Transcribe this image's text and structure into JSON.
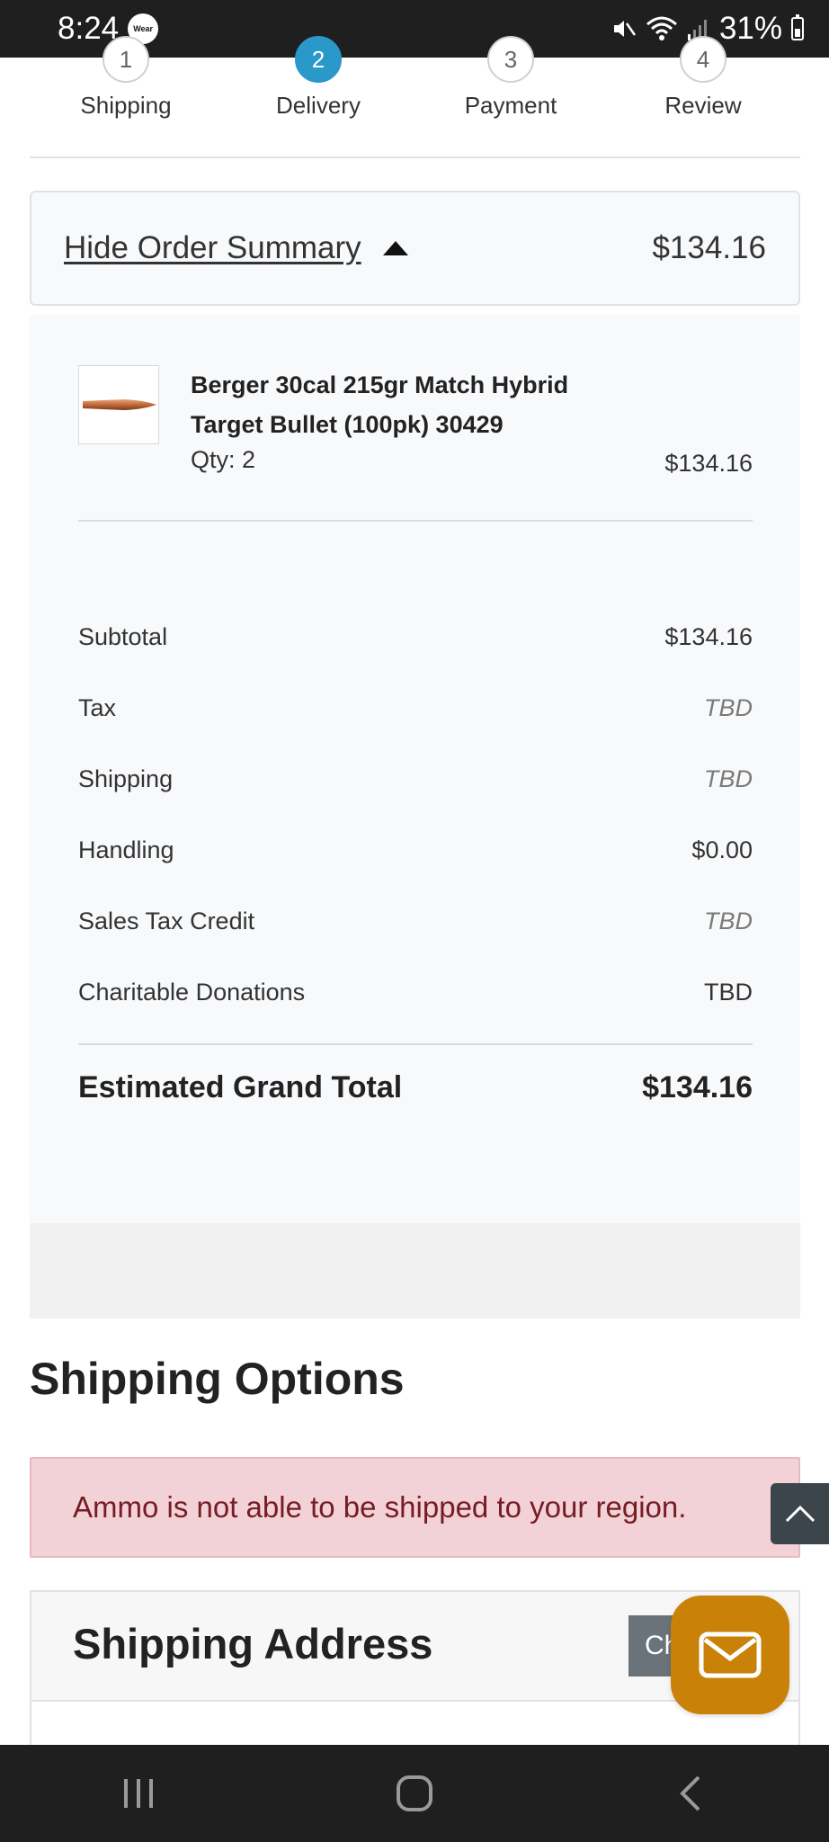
{
  "status_bar": {
    "time": "8:24",
    "wear_label": "Wear",
    "battery": "31%"
  },
  "stepper": [
    {
      "number": "1",
      "label": "Shipping",
      "active": false
    },
    {
      "number": "2",
      "label": "Delivery",
      "active": true
    },
    {
      "number": "3",
      "label": "Payment",
      "active": false
    },
    {
      "number": "4",
      "label": "Review",
      "active": false
    }
  ],
  "summary": {
    "toggle_label": "Hide Order Summary",
    "header_total": "$134.16",
    "product": {
      "name": "Berger 30cal 215gr Match Hybrid Target Bullet (100pk) 30429",
      "qty": "Qty: 2",
      "price": "$134.16"
    },
    "lines": [
      {
        "label": "Subtotal",
        "value": "$134.16"
      },
      {
        "label": "Tax",
        "value": "TBD"
      },
      {
        "label": "Shipping",
        "value": "TBD"
      },
      {
        "label": "Handling",
        "value": "$0.00"
      },
      {
        "label": "Sales Tax Credit",
        "value": "TBD"
      },
      {
        "label": "Charitable Donations",
        "value": "TBD"
      }
    ],
    "grand_total_label": "Estimated Grand Total",
    "grand_total_value": "$134.16"
  },
  "shipping_options": {
    "title": "Shipping Options",
    "alert": "Ammo is not able to be shipped to your region."
  },
  "shipping_address": {
    "title": "Shipping Address",
    "change_button": "Ch"
  },
  "colors": {
    "accent": "#2a98c8",
    "alert_bg": "#f2d2d6",
    "alert_text": "#761c24",
    "chat_fab": "#c98207"
  }
}
